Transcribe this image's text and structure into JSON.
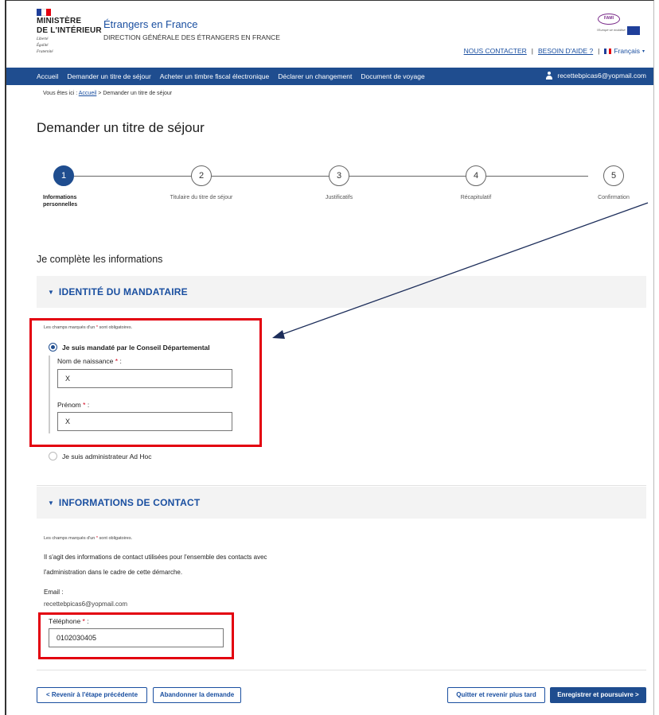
{
  "header": {
    "ministry_line1": "MINISTÈRE",
    "ministry_line2": "DE L'INTÉRIEUR",
    "devise": [
      "Liberté",
      "Égalité",
      "Fraternité"
    ],
    "site_title": "Étrangers en France",
    "site_subtitle": "DIRECTION GÉNÉRALE DES ÉTRANGERS EN FRANCE",
    "fami_logo_text": "FAMI",
    "fami_tagline": "l'Europe se mobilise",
    "links": {
      "contact": "NOUS CONTACTER",
      "help": "BESOIN D'AIDE ?",
      "language": "Français"
    }
  },
  "nav": {
    "items": [
      "Accueil",
      "Demander un titre de séjour",
      "Acheter un timbre fiscal électronique",
      "Déclarer un changement",
      "Document de voyage"
    ],
    "user_email": "recettebpicas6@yopmail.com"
  },
  "breadcrumb": {
    "prefix": "Vous êtes ici :",
    "home": "Accueil",
    "separator": ">",
    "current": "Demander un titre de séjour"
  },
  "page_title": "Demander un titre de séjour",
  "stepper": {
    "current_step": 1,
    "steps": [
      {
        "number": "1",
        "label": "Informations personnelles"
      },
      {
        "number": "2",
        "label": "Titulaire du titre de séjour"
      },
      {
        "number": "3",
        "label": "Justificatifs"
      },
      {
        "number": "4",
        "label": "Récapitulatif"
      },
      {
        "number": "5",
        "label": "Confirmation"
      }
    ]
  },
  "section_title": "Je complète les informations",
  "mandataire": {
    "title": "IDENTITÉ DU MANDATAIRE",
    "required_note_before": "Les champs marqués d'un",
    "required_note_star": "*",
    "required_note_after": "sont obligatoires.",
    "option_conseil": "Je suis mandaté par le Conseil Départemental",
    "option_conseil_selected": true,
    "nom_label": "Nom de naissance",
    "nom_value": "X",
    "prenom_label": "Prénom",
    "prenom_value": "X",
    "label_suffix": ":",
    "option_adhoc": "Je suis administrateur Ad Hoc",
    "option_adhoc_selected": false
  },
  "contact": {
    "title": "INFORMATIONS DE CONTACT",
    "required_note_before": "Les champs marqués d'un",
    "required_note_star": "*",
    "required_note_after": "sont obligatoires.",
    "info_line1": "Il s'agit des informations de contact utilisées pour l'ensemble des contacts avec",
    "info_line2": "l'administration dans le cadre de cette démarche.",
    "email_label": "Email :",
    "email_value": "recettebpicas6@yopmail.com",
    "phone_label": "Téléphone",
    "phone_value": "0102030405",
    "label_suffix": ":"
  },
  "actions": {
    "back": "< Revenir à l'étape précédente",
    "abandon": "Abandonner la demande",
    "quit": "Quitter et revenir plus tard",
    "save": "Enregistrer et poursuivre >"
  },
  "colors": {
    "brand_blue": "#1f4d8f",
    "link_blue": "#1a4fa0",
    "annotation_red": "#e3000f",
    "required_star": "#d0021b",
    "arrow": "#1c2d5a"
  },
  "icons": {
    "accordion": "chevron-down-icon",
    "user": "user-icon",
    "flag": "french-flag-icon",
    "eu_flag": "eu-flag-icon"
  }
}
